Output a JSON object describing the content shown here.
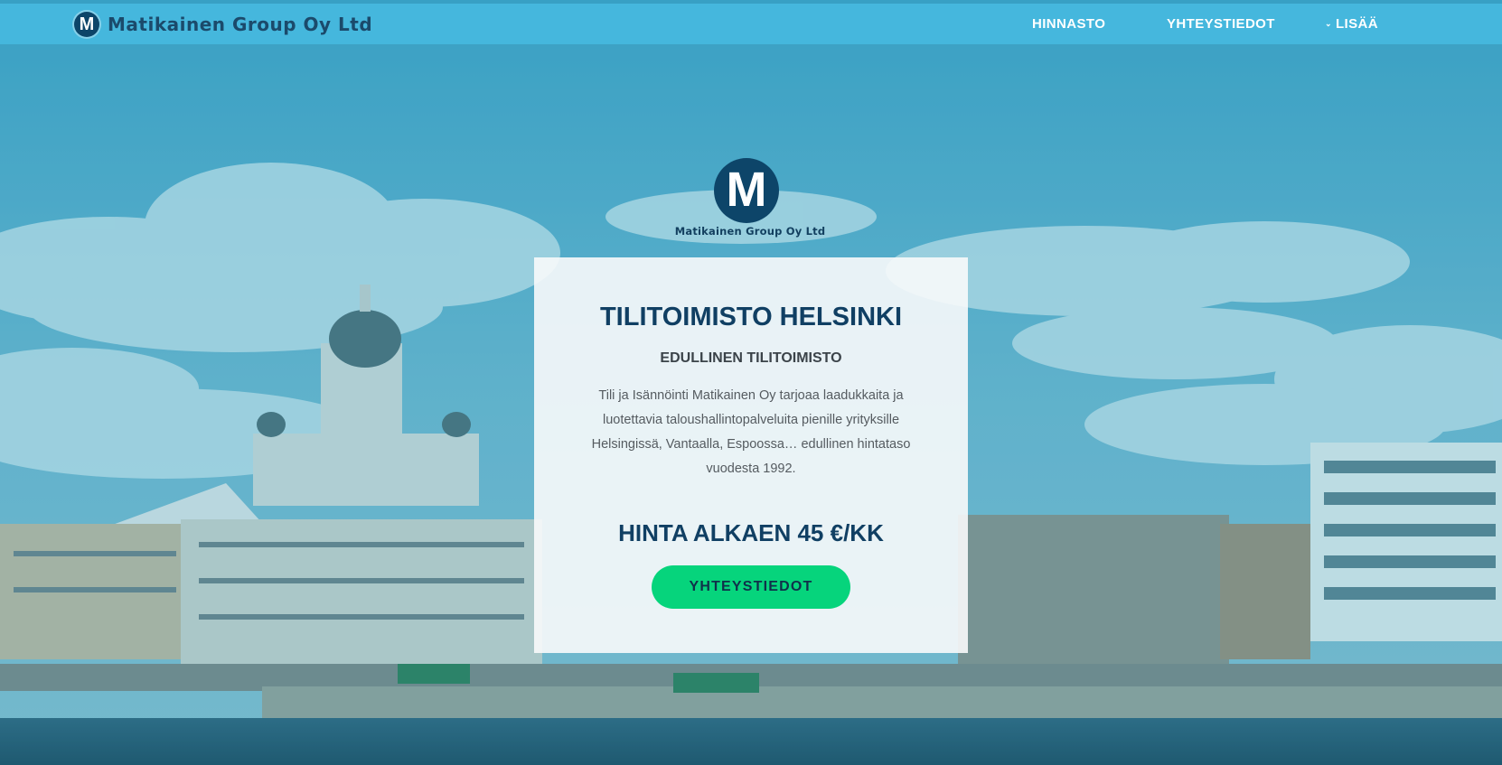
{
  "header": {
    "brand_name": "Matikainen Group Oy Ltd",
    "brand_logo_letter": "M",
    "nav": {
      "hinnasto": "HINNASTO",
      "yhteystiedot": "YHTEYSTIEDOT",
      "lisaa": "LISÄÄ"
    }
  },
  "hero": {
    "logo_letter": "M",
    "logo_name": "Matikainen Group Oy Ltd",
    "title": "TILITOIMISTO HELSINKI",
    "subtitle": "EDULLINEN TILITOIMISTO",
    "description": "Tili ja Isännöinti Matikainen Oy tarjoaa laadukkaita ja luotettavia taloushallintopalveluita pienille yrityksille Helsingissä, Vantaalla, Espoossa… edullinen hintataso vuodesta 1992.",
    "price": "HINTA ALKAEN 45 €/KK",
    "cta_label": "YHTEYSTIEDOT"
  },
  "colors": {
    "header_bg": "#46b8de",
    "brand_dark": "#0d4569",
    "cta_green": "#06d47c"
  }
}
